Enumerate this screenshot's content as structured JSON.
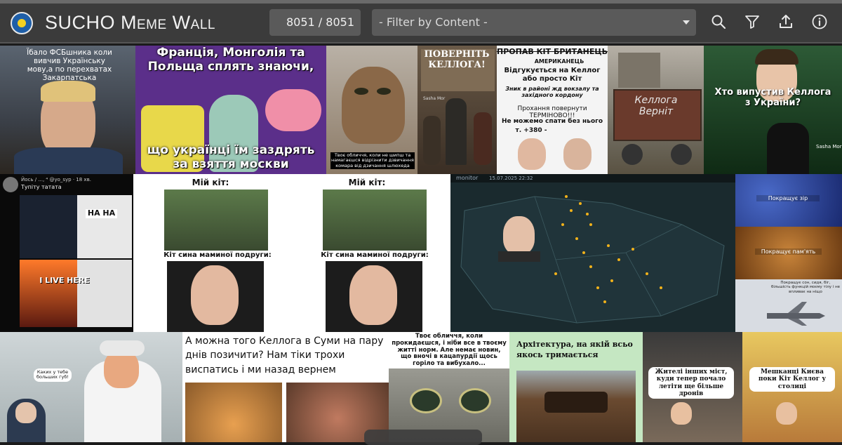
{
  "header": {
    "title": "SUCHO Meme Wall",
    "counter": "8051 / 8051",
    "filter_placeholder": "- Filter by Content -",
    "buttons": [
      "search-icon",
      "filter-icon",
      "share-icon",
      "info-icon"
    ]
  },
  "memes": {
    "m1": "Їбало ФСБшника коли вивчив Українську мову,а по перехватах Закарпатська",
    "m2": "Франція, Монголія та Польща сплять знаючи,",
    "m2b": "що українці їм заздрять за взяття москви",
    "m3": "Твоє обличчя, коли не шипш та намагаєшся відрізнити дзвичання комара від дзичання шлюхеда",
    "m4": "ПОВЕРНІТЬ КЕЛЛОГА!",
    "m4_credit": "Sasha Mor",
    "m5_title": "ПРОПАВ КІТ БРИТАНЕЦЬ",
    "m5_sub": "АМЕРИКАНЕЦЬ",
    "m5_l1": "Відгукується на Келлог або просто Кіт",
    "m5_l2": "Зник в районі жд вокзалу та західного кордону",
    "m5_l3": "Прохання повернути ТЕРМІНОВО!!!",
    "m5_l4": "Не можемо спати без нього",
    "m5_l5": "т. +380 -",
    "m6": "Келлога Верніт",
    "m7": "Хто випустив Келлога з України?",
    "m7_credit": "Sasha Mor",
    "m8_user": "Йось / ..., ⁴ @yo_syp · 18 хв.",
    "m8_text": "Тупіту татата",
    "m8_ha": "HA HA",
    "m8_live": "I LIVE HERE",
    "m9_l1": "Мій кіт:",
    "m9_l2": "Кіт сина маминої подруги:",
    "m10_bar": "monitor",
    "m10_date": "15.07.2025 22:32",
    "m11_l1": "Покращує зір",
    "m11_l2": "Покращує пам'ять",
    "m11_l3": "Покращує сон, сидя, біг, більшість функцій моєму тілу і не впливає на ніщо",
    "m12_bubble": "Каких у тебе больших губ!",
    "m13": "А можна того Келлога в Суми на пару днів позичити? Нам тіки трохи виспатись і ми назад вернем",
    "m14": "Твоє обличчя, коли прокидаєшся, і ніби все в твоєму житті норм. Але немає новин, що вночі в кацапурдії щось горіло та вибухало...",
    "m15": "Архітектура, на якій всьо якось тримається",
    "m16_l": "Жителі інших міст, куди тепер почало летіти ще більше дронів",
    "m16_r": "Мешканці Києва поки Кіт Келлог у столиці"
  },
  "colors": {
    "header_bg": "#3b3b3b",
    "field_bg": "#5a5a5a",
    "page_bg": "#1b1b1b"
  }
}
